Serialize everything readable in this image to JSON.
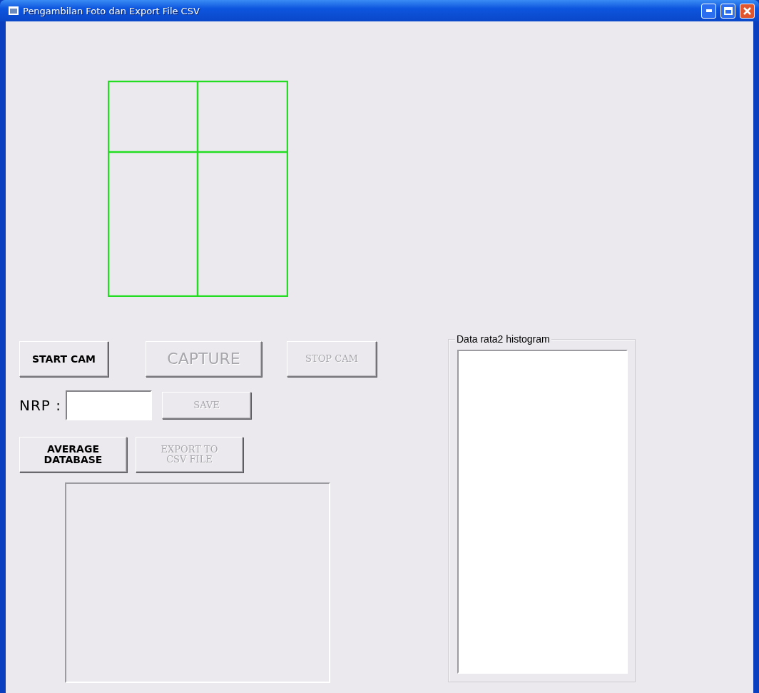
{
  "window": {
    "title": "Pengambilan Foto dan Export File CSV"
  },
  "camera_buttons": [
    {
      "label": "START CAM",
      "disabled": false
    },
    {
      "label": "CAPTURE",
      "disabled": true
    },
    {
      "label": "STOP CAM",
      "disabled": true
    }
  ],
  "nrp": {
    "label": "NRP :",
    "save_button": {
      "label": "SAVE",
      "disabled": true
    }
  },
  "database_buttons": [
    {
      "label": "AVERAGE\nDATABASE",
      "disabled": false
    },
    {
      "label": "EXPORT TO\nCSV FILE",
      "disabled": true
    }
  ],
  "histogram_group": {
    "title": "Data rata2 histogram"
  }
}
